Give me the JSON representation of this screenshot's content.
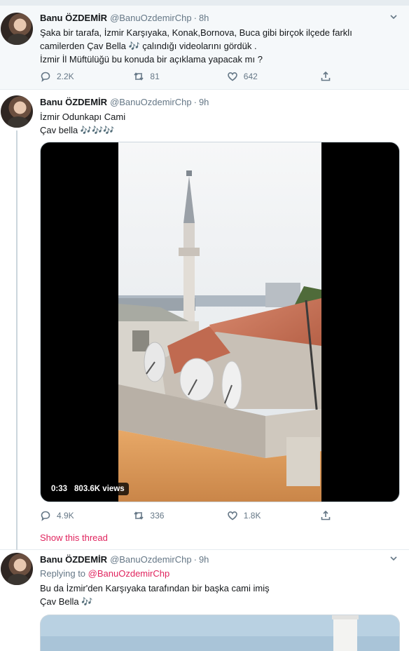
{
  "tweets": [
    {
      "name": "Banu ÖZDEMİR",
      "handle": "@BanuOzdemirChp",
      "separator": "·",
      "time": "8h",
      "lines": [
        "Şaka bir tarafa, İzmir Karşıyaka, Konak,Bornova, Buca gibi birçok ilçede farklı",
        "camilerden Çav Bella 🎶 çalındığı videolarını gördük .",
        "İzmir İl Müftülüğü bu konuda bir açıklama yapacak mı ?"
      ],
      "replies": "2.2K",
      "retweets": "81",
      "likes": "642"
    },
    {
      "name": "Banu ÖZDEMİR",
      "handle": "@BanuOzdemirChp",
      "separator": "·",
      "time": "9h",
      "lines": [
        "İzmir Odunkapı Cami",
        "Çav bella 🎶🎶🎶"
      ],
      "video_duration": "0:33",
      "video_views": "803.6K views",
      "replies": "4.9K",
      "retweets": "336",
      "likes": "1.8K",
      "show_thread": "Show this thread"
    },
    {
      "name": "Banu ÖZDEMİR",
      "handle": "@BanuOzdemirChp",
      "separator": "·",
      "time": "9h",
      "replying_prefix": "Replying to",
      "replying_to": "@BanuOzdemirChp",
      "lines": [
        "Bu da İzmir'den Karşıyaka tarafından bir başka cami imiş",
        "Çav Bella 🎶"
      ]
    }
  ],
  "icons": {
    "reply": "reply-icon",
    "retweet": "retweet-icon",
    "like": "heart-icon",
    "share": "share-icon",
    "more": "chevron-down-icon"
  },
  "colors": {
    "accent": "#e0245e",
    "secondary_text": "#657786",
    "border": "#e6ecf0"
  }
}
